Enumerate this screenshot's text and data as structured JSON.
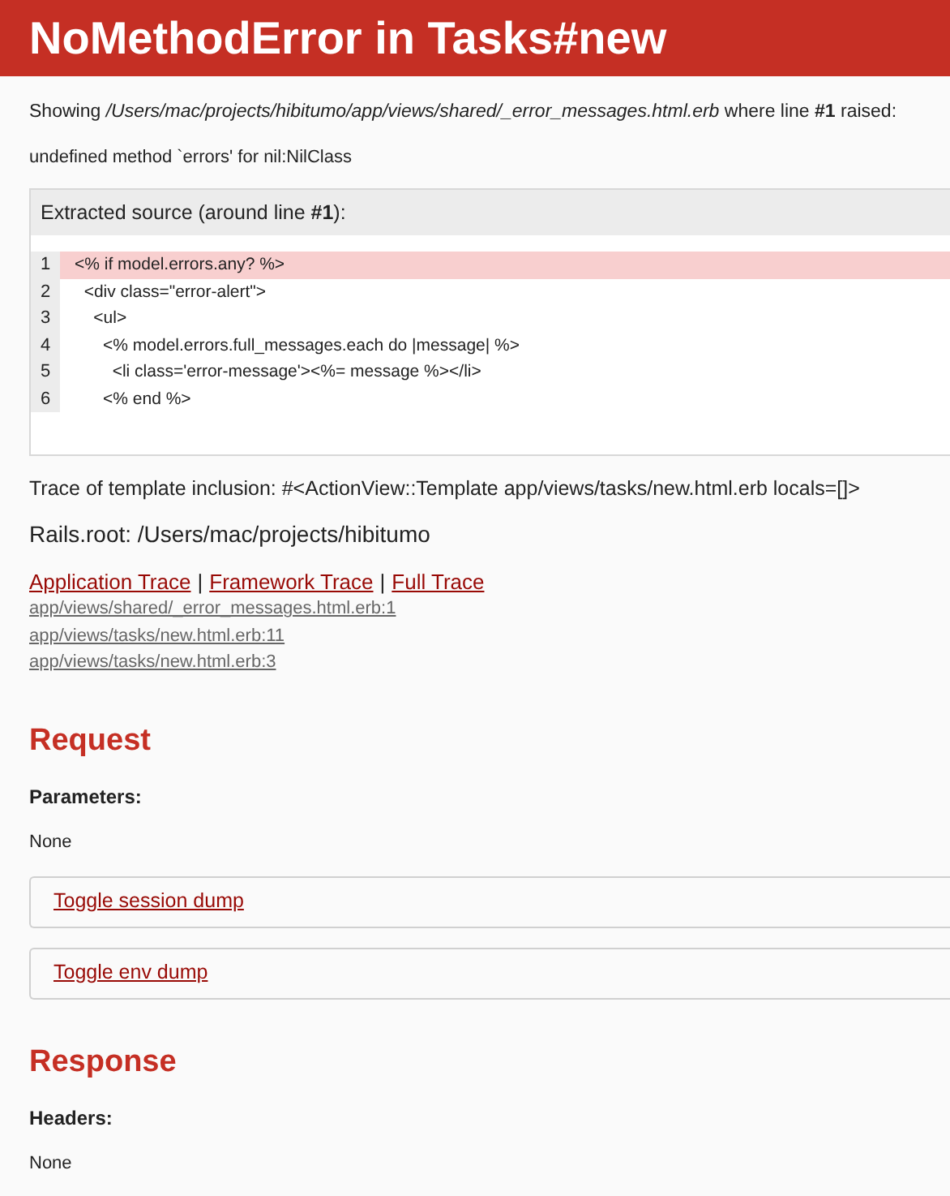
{
  "title": "NoMethodError in Tasks#new",
  "showing": "Showing */Users/mac/projects/hibitumo/app/views/shared/_error_messages.html.erb* where line **#1** raised:",
  "message": "undefined method `errors' for nil:NilClass",
  "source": {
    "heading": "Extracted source (around line **#1**):",
    "lines": [
      {
        "number": "1",
        "code": "<% if model.errors.any? %>",
        "selected": true
      },
      {
        "number": "2",
        "code": "  <div class=\"error-alert\">",
        "selected": false
      },
      {
        "number": "3",
        "code": "    <ul>",
        "selected": false
      },
      {
        "number": "4",
        "code": "      <% model.errors.full_messages.each do |message| %>",
        "selected": false
      },
      {
        "number": "5",
        "code": "        <li class='error-message'><%= message %></li>",
        "selected": false
      },
      {
        "number": "6",
        "code": "      <% end %>",
        "selected": false
      }
    ]
  },
  "template_trace": "Trace of template inclusion: #<ActionView::Template app/views/tasks/new.html.erb locals=[]>",
  "rails_root": "Rails.root: /Users/mac/projects/hibitumo",
  "trace_links": [
    "Application Trace",
    "Framework Trace",
    "Full Trace"
  ],
  "trace_separator": "|",
  "trace_lines": [
    "app/views/shared/_error_messages.html.erb:1",
    "app/views/tasks/new.html.erb:11",
    "app/views/tasks/new.html.erb:3"
  ],
  "sections": [
    {
      "heading": "Request",
      "subheading": "Parameters:",
      "value": "None",
      "toggles": [
        "Toggle session dump",
        "Toggle env dump"
      ]
    },
    {
      "heading": "Response",
      "subheading": "Headers:",
      "value": "None"
    }
  ]
}
